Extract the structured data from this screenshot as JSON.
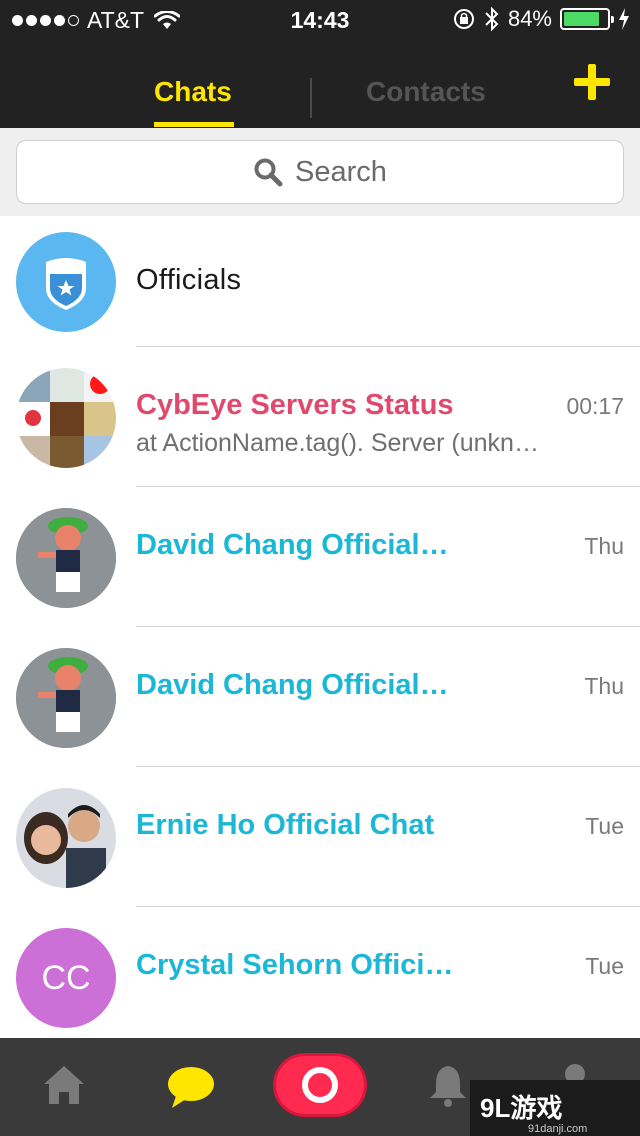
{
  "status_bar": {
    "carrier": "AT&T",
    "time": "14:43",
    "battery_percent": "84%",
    "battery_level": 0.84,
    "signal_bars": 4
  },
  "header": {
    "tabs": [
      {
        "label": "Chats",
        "active": true
      },
      {
        "label": "Contacts",
        "active": false
      }
    ],
    "accent": "#ffe600"
  },
  "search": {
    "placeholder": "Search"
  },
  "chats": [
    {
      "name": "Officials",
      "avatar": "shield-star-icon"
    },
    {
      "name": "CybEye Servers Status",
      "preview": "at ActionName.tag(). Server (unkn…",
      "time": "00:17",
      "color": "#e0496d"
    },
    {
      "name": "David Chang Official…",
      "time": "Thu",
      "color": "#1ab7d6"
    },
    {
      "name": "David Chang Official…",
      "time": "Thu",
      "color": "#1ab7d6"
    },
    {
      "name": "Ernie Ho Official Chat",
      "time": "Tue",
      "color": "#1ab7d6"
    },
    {
      "name": "Crystal Sehorn  Offici…",
      "time": "Tue",
      "initials": "CC",
      "color": "#1ab7d6"
    }
  ],
  "tabbar": {
    "items": [
      "home-icon",
      "chat-bubble-icon",
      "camera-record-icon",
      "bell-icon",
      "profile-icon"
    ],
    "active": "chat-bubble-icon"
  },
  "watermark": {
    "text": "9L游戏",
    "sub": "91danji.com"
  }
}
